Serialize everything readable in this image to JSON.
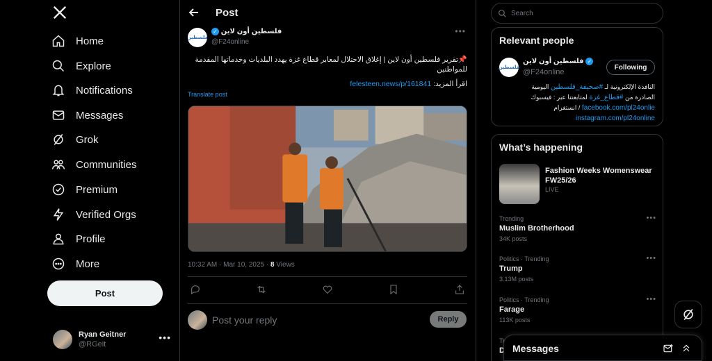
{
  "nav": {
    "items": [
      {
        "label": "Home",
        "icon": "home-icon"
      },
      {
        "label": "Explore",
        "icon": "search-icon"
      },
      {
        "label": "Notifications",
        "icon": "bell-icon"
      },
      {
        "label": "Messages",
        "icon": "envelope-icon"
      },
      {
        "label": "Grok",
        "icon": "grok-icon"
      },
      {
        "label": "Communities",
        "icon": "people-icon"
      },
      {
        "label": "Premium",
        "icon": "x-badge-icon"
      },
      {
        "label": "Verified Orgs",
        "icon": "lightning-icon"
      },
      {
        "label": "Profile",
        "icon": "person-icon"
      },
      {
        "label": "More",
        "icon": "more-circle-icon"
      }
    ],
    "post_label": "Post",
    "account": {
      "name": "Ryan Geitner",
      "handle": "@RGeit"
    }
  },
  "main": {
    "header_title": "Post",
    "author": {
      "name": "فلسطين أون لاين",
      "handle": "@F24online",
      "avatar_text": "فلسطين"
    },
    "text_line1": "📌تقرير فلسطين أون لاين | إغلاق الاحتلال لمعابر قطاع غزة يهدد البلديات وخدماتها المقدمة للمواطنين",
    "read_more_label": "اقرأ المزيد: ",
    "read_more_link": "felesteen.news/p/161841",
    "translate_label": "Translate post",
    "meta_time": "10:32 AM · Mar 10, 2025 · ",
    "meta_views_count": "8",
    "meta_views_label": " Views",
    "reply_placeholder": "Post your reply",
    "reply_button": "Reply"
  },
  "sidebar": {
    "search_placeholder": "Search",
    "relevant": {
      "title": "Relevant people",
      "name": "فلسطين أون لاين",
      "handle": "@F24online",
      "follow_label": "Following",
      "bio_line1_prefix": "النافذة الإلكترونية لـ ",
      "bio_tag1": "#صحيفة_فلسطين",
      "bio_line1_suffix": " اليومية",
      "bio_line2_prefix": "الصادرة من ",
      "bio_tag2": "#قطاع_غزة",
      "bio_line2_suffix": " لمتابعتنا عبر : فيسبوك",
      "bio_link1": "facebook.com/pl24onlie",
      "bio_link2_prefix": " / انستغرام",
      "bio_link2": "instagram.com/pl24online"
    },
    "happening": {
      "title": "What’s happening",
      "event_title": "Fashion Weeks Womenswear FW25/26",
      "event_status": "LIVE",
      "trends": [
        {
          "category": "Trending",
          "name": "Muslim Brotherhood",
          "count": "34K posts"
        },
        {
          "category": "Politics · Trending",
          "name": "Trump",
          "count": "3.13M posts"
        },
        {
          "category": "Politics · Trending",
          "name": "Farage",
          "count": "113K posts"
        },
        {
          "category": "Tr",
          "name": "D",
          "count": ""
        }
      ]
    },
    "messages_title": "Messages"
  }
}
